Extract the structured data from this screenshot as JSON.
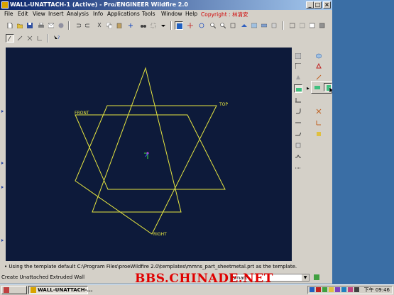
{
  "window": {
    "title": "WALL-UNATTACH-1 (Active) - Pro/ENGINEER Wildfire 2.0"
  },
  "menu": {
    "items": [
      "File",
      "Edit",
      "View",
      "Insert",
      "Analysis",
      "Info",
      "Applications",
      "Tools",
      "Window",
      "Help"
    ],
    "copyright": "Copyright : 林清安"
  },
  "viewport": {
    "labels": {
      "front": "FRONT",
      "top": "TOP",
      "right": "RIGHT"
    },
    "colors": {
      "background": "#0d1a3a",
      "datum": "#e6e640"
    }
  },
  "message": "• Using the template default C:\\Program Files\\proeWildfire 2.0\\templates\\mmns_part_sheetmetal.prt as the template.",
  "status": {
    "prompt": "Create Unattached Extruded Wall",
    "filter": "Smart"
  },
  "watermark": "BBS.CHINADE.NET",
  "taskbar": {
    "tasks": [
      "",
      "WALL-UNATTACH-..."
    ],
    "clock": "下午 09:46"
  }
}
